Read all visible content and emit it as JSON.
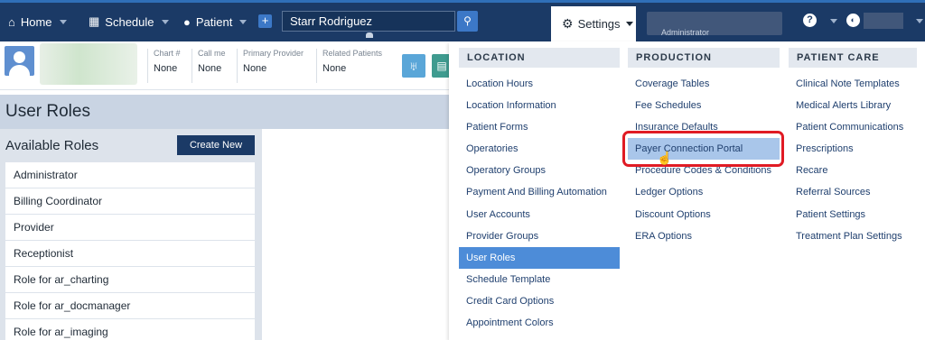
{
  "nav": {
    "home": "Home",
    "schedule": "Schedule",
    "patient": "Patient",
    "current_patient": "Starr Rodriguez",
    "settings": "Settings",
    "location_role": "Administrator"
  },
  "patient_header": {
    "fields": [
      {
        "label": "Chart #",
        "value": "None"
      },
      {
        "label": "Call me",
        "value": "None"
      },
      {
        "label": "Primary Provider",
        "value": "None"
      },
      {
        "label": "Related Patients",
        "value": "None"
      }
    ]
  },
  "page": {
    "title": "User Roles",
    "available_roles_title": "Available Roles",
    "create_new_label": "Create New",
    "roles": [
      "Administrator",
      "Billing Coordinator",
      "Provider",
      "Receptionist",
      "Role for ar_charting",
      "Role for ar_docmanager",
      "Role for ar_imaging"
    ]
  },
  "settings_menu": {
    "location": {
      "header": "LOCATION",
      "items": [
        "Location Hours",
        "Location Information",
        "Patient Forms",
        "Operatories",
        "Operatory Groups",
        "Payment And Billing Automation",
        "User Accounts",
        "Provider Groups",
        "User Roles",
        "Schedule Template",
        "Credit Card Options",
        "Appointment Colors"
      ],
      "active_item": "User Roles"
    },
    "production": {
      "header": "PRODUCTION",
      "items": [
        "Coverage Tables",
        "Fee Schedules",
        "Insurance Defaults",
        "Payer Connection Portal",
        "Procedure Codes & Conditions",
        "Ledger Options",
        "Discount Options",
        "ERA Options"
      ],
      "hovered_item": "Payer Connection Portal"
    },
    "patient_care": {
      "header": "PATIENT CARE",
      "items": [
        "Clinical Note Templates",
        "Medical Alerts Library",
        "Patient Communications",
        "Prescriptions",
        "Recare",
        "Referral Sources",
        "Patient Settings",
        "Treatment Plan Settings"
      ]
    }
  },
  "colors": {
    "nav_bg": "#1b3a66",
    "active_item": "#4d8cd8",
    "hover_item": "#a9c6ea",
    "highlight_ring": "#e01b24"
  }
}
